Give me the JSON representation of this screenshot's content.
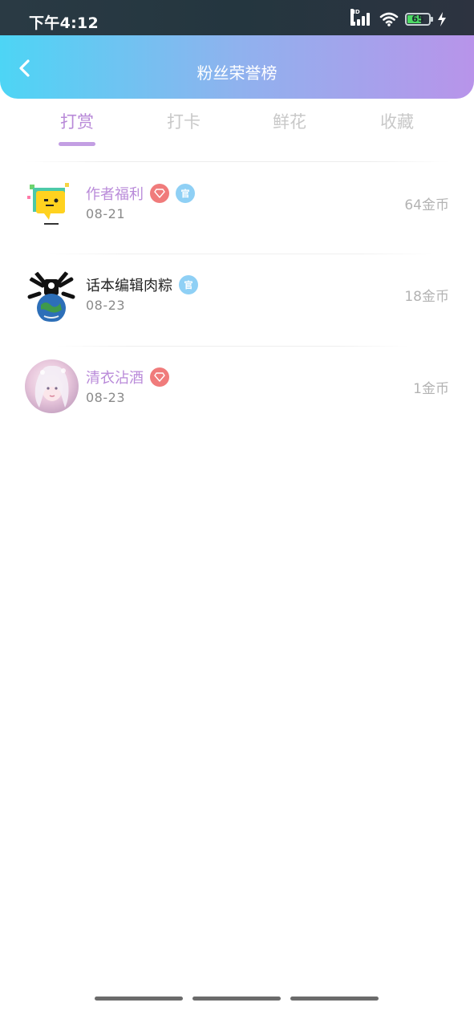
{
  "status_bar": {
    "time": "下午4:12",
    "network_label": "HD",
    "battery_level": "65",
    "battery_percent": 65
  },
  "header": {
    "title": "粉丝荣誉榜"
  },
  "tabs": [
    {
      "label": "打赏",
      "active": true
    },
    {
      "label": "打卡",
      "active": false
    },
    {
      "label": "鲜花",
      "active": false
    },
    {
      "label": "收藏",
      "active": false
    }
  ],
  "fans": [
    {
      "name": "作者福利",
      "date": "08-21",
      "coins": "64金币",
      "badges": [
        "diamond-icon",
        "guan-icon"
      ],
      "name_color": "#b98ad9"
    },
    {
      "name": "话本编辑肉粽",
      "date": "08-23",
      "coins": "18金币",
      "badges": [
        "guan-icon"
      ],
      "name_color": "#222222"
    },
    {
      "name": "清衣沾酒",
      "date": "08-23",
      "coins": "1金币",
      "badges": [
        "diamond-icon"
      ],
      "name_color": "#b98ad9"
    }
  ],
  "badge_text": {
    "guan": "官"
  },
  "colors": {
    "accent": "#b889d8",
    "header_gradient_start": "#4dd5f5",
    "header_gradient_end": "#b894ea",
    "diamond_badge": "#f07b7b",
    "guan_badge": "#8fd0f5"
  }
}
